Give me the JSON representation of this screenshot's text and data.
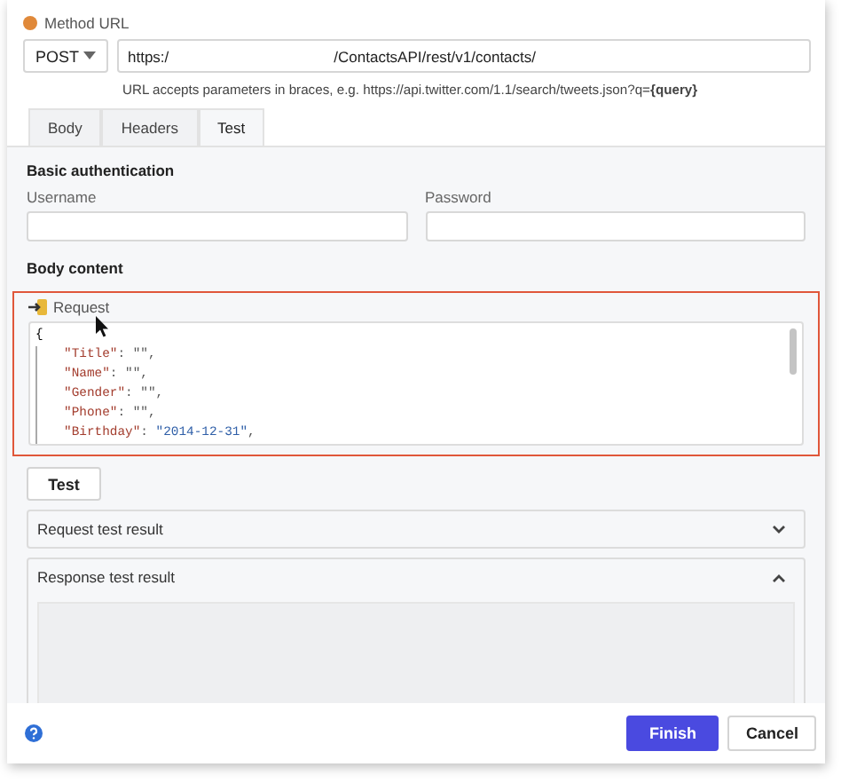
{
  "method_url": {
    "label": "Method URL",
    "method": "POST",
    "url_parts": [
      "https:/",
      "/ContactsAPI/rest/v1/contacts/"
    ],
    "hint": "URL accepts parameters in braces, e.g. https://api.twitter.com/1.1/search/tweets.json?q=**{query}**"
  },
  "tabs": [
    {
      "label": "Body",
      "selected": false
    },
    {
      "label": "Headers",
      "selected": false
    },
    {
      "label": "Test",
      "selected": true
    }
  ],
  "basic_authentication": {
    "title": "Basic authentication",
    "username": {
      "label": "Username"
    },
    "password": {
      "label": "Password"
    }
  },
  "body_content": {
    "title": "Body content",
    "request_label": "Request",
    "highlighted": true,
    "open_line": "{",
    "lines": [
      {
        "key": "\"Title\"",
        "sep": ": ",
        "value": "\"\"",
        "end": ","
      },
      {
        "key": "\"Name\"",
        "sep": ": ",
        "value": "\"\"",
        "end": ","
      },
      {
        "key": "\"Gender\"",
        "sep": ": ",
        "value": "\"\"",
        "end": ","
      },
      {
        "key": "\"Phone\"",
        "sep": ": ",
        "value": "\"\"",
        "end": ","
      },
      {
        "key": "\"Birthday\"",
        "sep": ": ",
        "value": "\"2014-12-31\"",
        "end": ","
      }
    ]
  },
  "test_button": "Test",
  "results": [
    {
      "title": "Request test result",
      "expanded": false
    },
    {
      "title": "Response test result",
      "expanded": true
    }
  ],
  "footer": {
    "buttons": [
      {
        "label": "Finish",
        "kind": "primary"
      },
      {
        "label": "Cancel",
        "kind": "secondary"
      }
    ]
  }
}
